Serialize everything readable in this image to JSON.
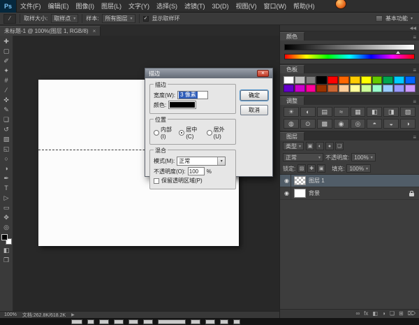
{
  "app": {
    "logo": "Ps"
  },
  "menu": {
    "items": [
      "文件(F)",
      "编辑(E)",
      "图像(I)",
      "图层(L)",
      "文字(Y)",
      "选择(S)",
      "滤镜(T)",
      "3D(D)",
      "视图(V)",
      "窗口(W)",
      "帮助(H)"
    ]
  },
  "options": {
    "sample_size_label": "取样大小:",
    "sample_size_value": "取样点",
    "sample_label": "样本:",
    "sample_value": "所有图层",
    "show_ring_label": "显示取样环",
    "check_glyph": "✓",
    "workspace": "基本功能",
    "dropdown_arrow": "▾"
  },
  "tabbar": {
    "doc_title": "未标题-1 @ 100%(图层 1, RGB/8)",
    "close_glyph": "×"
  },
  "toolbar": {
    "tools": [
      {
        "name": "move-tool",
        "glyph": "✚"
      },
      {
        "name": "rectangular-marquee-tool",
        "glyph": "▢"
      },
      {
        "name": "lasso-tool",
        "glyph": "✐"
      },
      {
        "name": "quick-selection-tool",
        "glyph": "✦"
      },
      {
        "name": "crop-tool",
        "glyph": "#"
      },
      {
        "name": "eyedropper-tool",
        "glyph": "⁄"
      },
      {
        "name": "spot-healing-tool",
        "glyph": "✜"
      },
      {
        "name": "brush-tool",
        "glyph": "✎"
      },
      {
        "name": "clone-stamp-tool",
        "glyph": "❏"
      },
      {
        "name": "history-brush-tool",
        "glyph": "↺"
      },
      {
        "name": "eraser-tool",
        "glyph": "▧"
      },
      {
        "name": "gradient-tool",
        "glyph": "◱"
      },
      {
        "name": "blur-tool",
        "glyph": "○"
      },
      {
        "name": "dodge-tool",
        "glyph": "◑"
      },
      {
        "name": "pen-tool",
        "glyph": "✒"
      },
      {
        "name": "type-tool",
        "glyph": "T"
      },
      {
        "name": "path-selection-tool",
        "glyph": "▷"
      },
      {
        "name": "rectangle-tool",
        "glyph": "▭"
      },
      {
        "name": "hand-tool",
        "glyph": "✥"
      },
      {
        "name": "zoom-tool",
        "glyph": "◎"
      }
    ],
    "extras": [
      {
        "name": "quick-mask-mode-button",
        "glyph": "◧"
      },
      {
        "name": "screen-mode-button",
        "glyph": "❐"
      }
    ]
  },
  "dialog": {
    "title": "描边",
    "close_glyph": "×",
    "stroke": {
      "group_label": "描边",
      "width_label": "宽度(W):",
      "width_value": "3 像素",
      "color_label": "颜色:",
      "color_value": "#000000"
    },
    "position": {
      "group_label": "位置",
      "options": [
        {
          "label": "内部(I)",
          "checked": false
        },
        {
          "label": "居中(C)",
          "checked": true
        },
        {
          "label": "居外(U)",
          "checked": false
        }
      ]
    },
    "blend": {
      "group_label": "混合",
      "mode_label": "模式(M):",
      "mode_value": "正常",
      "opacity_label": "不透明度(O):",
      "opacity_value": "100",
      "percent_label": "%",
      "preserve_label": "保留透明区域(P)",
      "dropdown_arrow": "▾"
    },
    "buttons": {
      "ok": "确定",
      "cancel": "取消"
    }
  },
  "panels": {
    "dock_collapse_glyph": "◀◀",
    "panel_menu_glyph": "≡",
    "color": {
      "tab": "颜色"
    },
    "swatches": {
      "tab": "色板",
      "colors": [
        "#ffffff",
        "#c0c0c0",
        "#808080",
        "#000000",
        "#ff0000",
        "#ff6600",
        "#ffcc00",
        "#ffff00",
        "#66cc00",
        "#00a651",
        "#00ccff",
        "#0066ff",
        "#6600cc",
        "#cc00cc",
        "#ff0099",
        "#993300",
        "#cc6633",
        "#ffcc99",
        "#ffff99",
        "#ccff99",
        "#99ffcc",
        "#99ccff",
        "#9999ff",
        "#cc99ff"
      ]
    },
    "adjustments": {
      "tab": "调整",
      "icon_rows": [
        [
          "☀",
          "◐",
          "▤",
          "≈",
          "▦",
          "◧",
          "◨",
          "▧"
        ],
        [
          "◍",
          "⊙",
          "▩",
          "◉",
          "◎",
          "◓",
          "◒",
          "◑"
        ]
      ]
    },
    "layers": {
      "tab": "图层",
      "filter_label": "类型",
      "filter_icons": [
        "▣",
        "◐",
        "●",
        "❏"
      ],
      "blend_mode": "正常",
      "opacity_label": "不透明度:",
      "opacity_value": "100%",
      "lock_label": "锁定:",
      "lock_icons": [
        "▨",
        "✚",
        "▣"
      ],
      "fill_label": "填充:",
      "fill_value": "100%",
      "eye_glyph": "◉",
      "dropdown_arrow": "▾",
      "rows": [
        {
          "name": "图层 1",
          "selected": true,
          "thumb": "checker",
          "locked": false
        },
        {
          "name": "背景",
          "selected": false,
          "thumb": "white",
          "locked": true
        }
      ],
      "bottom_icons": [
        {
          "name": "link-layers-icon",
          "glyph": "∞"
        },
        {
          "name": "layer-effects-icon",
          "glyph": "fx"
        },
        {
          "name": "layer-mask-icon",
          "glyph": "◧"
        },
        {
          "name": "adjustment-layer-icon",
          "glyph": "◑"
        },
        {
          "name": "layer-group-icon",
          "glyph": "❏"
        },
        {
          "name": "new-layer-icon",
          "glyph": "⊞"
        },
        {
          "name": "delete-layer-icon",
          "glyph": "⌦"
        }
      ]
    }
  },
  "statusbar": {
    "zoom": "100%",
    "doc_info": "文档:262.8K/618.2K",
    "arrow_glyph": "▶"
  },
  "taskbar": {
    "chip_widths": [
      16,
      10,
      14,
      14,
      14,
      14,
      40,
      14,
      14,
      12,
      10
    ]
  }
}
